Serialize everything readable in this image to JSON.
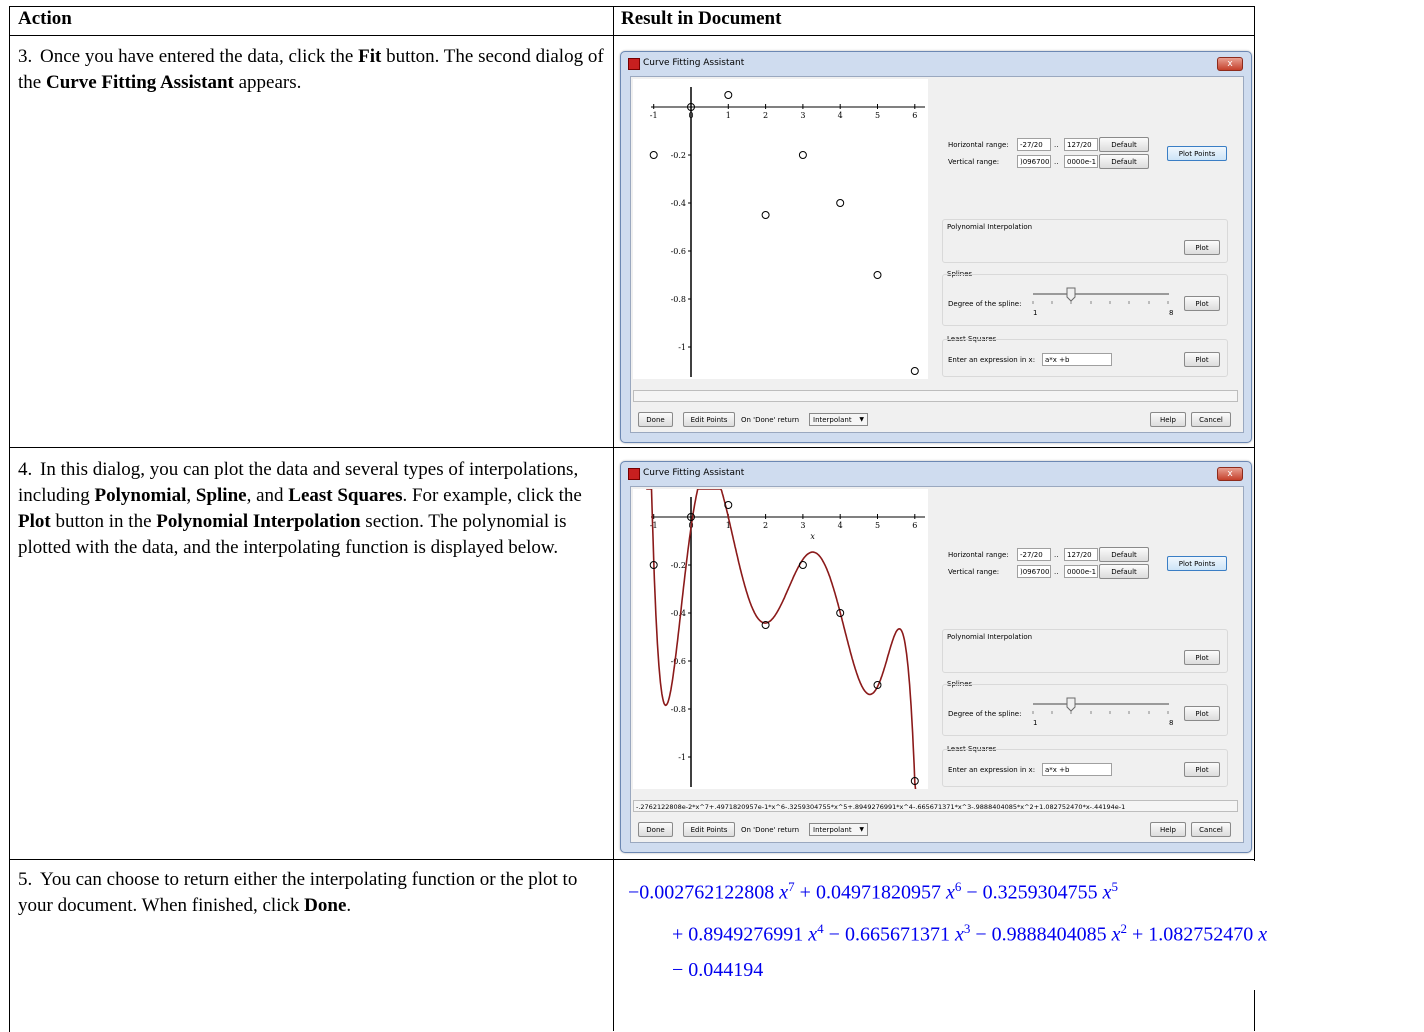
{
  "table": {
    "col_action": "Action",
    "col_result": "Result in Document"
  },
  "steps": [
    {
      "num": "3.",
      "parts": [
        {
          "t": "Once you have entered the data, click the ",
          "b": false
        },
        {
          "t": "Fit",
          "b": true
        },
        {
          "t": " button. The second dialog of the ",
          "b": false
        },
        {
          "t": "Curve Fitting Assistant",
          "b": true
        },
        {
          "t": " appears.",
          "b": false
        }
      ]
    },
    {
      "num": "4.",
      "parts": [
        {
          "t": "In this dialog, you can plot the data and several types of interpolations, including ",
          "b": false
        },
        {
          "t": "Polynomial",
          "b": true
        },
        {
          "t": ", ",
          "b": false
        },
        {
          "t": "Spline",
          "b": true
        },
        {
          "t": ", and ",
          "b": false
        },
        {
          "t": "Least Squares",
          "b": true
        },
        {
          "t": ". For example, click the ",
          "b": false
        },
        {
          "t": "Plot",
          "b": true
        },
        {
          "t": " button in the ",
          "b": false
        },
        {
          "t": "Polynomial Interpolation",
          "b": true
        },
        {
          "t": " section. The polynomial is plotted with the data, and the interpolating function is displayed below.",
          "b": false
        }
      ]
    },
    {
      "num": "5.",
      "parts": [
        {
          "t": "You can choose to return either the interpolating function or the plot to your document. When finished, click ",
          "b": false
        },
        {
          "t": "Done",
          "b": true
        },
        {
          "t": ".",
          "b": false
        }
      ]
    }
  ],
  "dialog": {
    "title": "Curve Fitting Assistant",
    "close": "x",
    "horizontal_range_label": "Horizontal range:",
    "horizontal_min": "-27/20",
    "horizontal_max": "127/20",
    "vertical_range_label": "Vertical range:",
    "vertical_min": ")096700",
    "vertical_max": "0000e-1",
    "range_sep": "..",
    "default_label": "Default",
    "plot_points_label": "Plot Points",
    "poly_section": "Polynomial Interpolation",
    "plot_label": "Plot",
    "splines_section": "Splines",
    "spline_degree_label": "Degree of the spline:",
    "spline_min": "1",
    "spline_max": "8",
    "least_squares_section": "Least Squares",
    "expression_label": "Enter an expression in x:",
    "expression_value": "a*x +b",
    "done_label": "Done",
    "edit_points_label": "Edit Points",
    "on_done_label": "On 'Done' return",
    "return_selected": "Interpolant",
    "help_label": "Help",
    "cancel_label": "Cancel",
    "status_1": "",
    "status_2": "-.2762122808e-2*x^7+.4971820957e-1*x^6-.3259304755*x^5+.8949276991*x^4-.665671371*x^3-.9888404085*x^2+1.082752470*x-.44194e-1",
    "x_axis_label": "x",
    "x_ticks": [
      "-1",
      "0",
      "1",
      "2",
      "3",
      "4",
      "5",
      "6"
    ],
    "y_ticks": [
      "-0.2",
      "-0.4",
      "-0.6",
      "-0.8",
      "-1"
    ],
    "points": [
      [
        -1,
        -0.2
      ],
      [
        0,
        0
      ],
      [
        1,
        0.05
      ],
      [
        2,
        -0.45
      ],
      [
        3,
        -0.2
      ],
      [
        4,
        -0.4
      ],
      [
        5,
        -0.7
      ],
      [
        6,
        -1.1
      ]
    ],
    "curve_color": "#8b1a1a"
  },
  "result": {
    "line1": [
      {
        "c": "−0.002762122808 ",
        "v": "x",
        "p": "7"
      },
      {
        "c": " + 0.04971820957 ",
        "v": "x",
        "p": "6"
      },
      {
        "c": " − 0.3259304755 ",
        "v": "x",
        "p": "5"
      }
    ],
    "line2": [
      {
        "c": "+ 0.8949276991 ",
        "v": "x",
        "p": "4"
      },
      {
        "c": " − 0.665671371 ",
        "v": "x",
        "p": "3"
      },
      {
        "c": " − 0.9888404085 ",
        "v": "x",
        "p": "2"
      },
      {
        "c": " + 1.082752470 ",
        "v": "x",
        "p": ""
      }
    ],
    "line3": [
      {
        "c": "− 0.044194",
        "v": "",
        "p": ""
      }
    ],
    "color": "#0000ee"
  }
}
